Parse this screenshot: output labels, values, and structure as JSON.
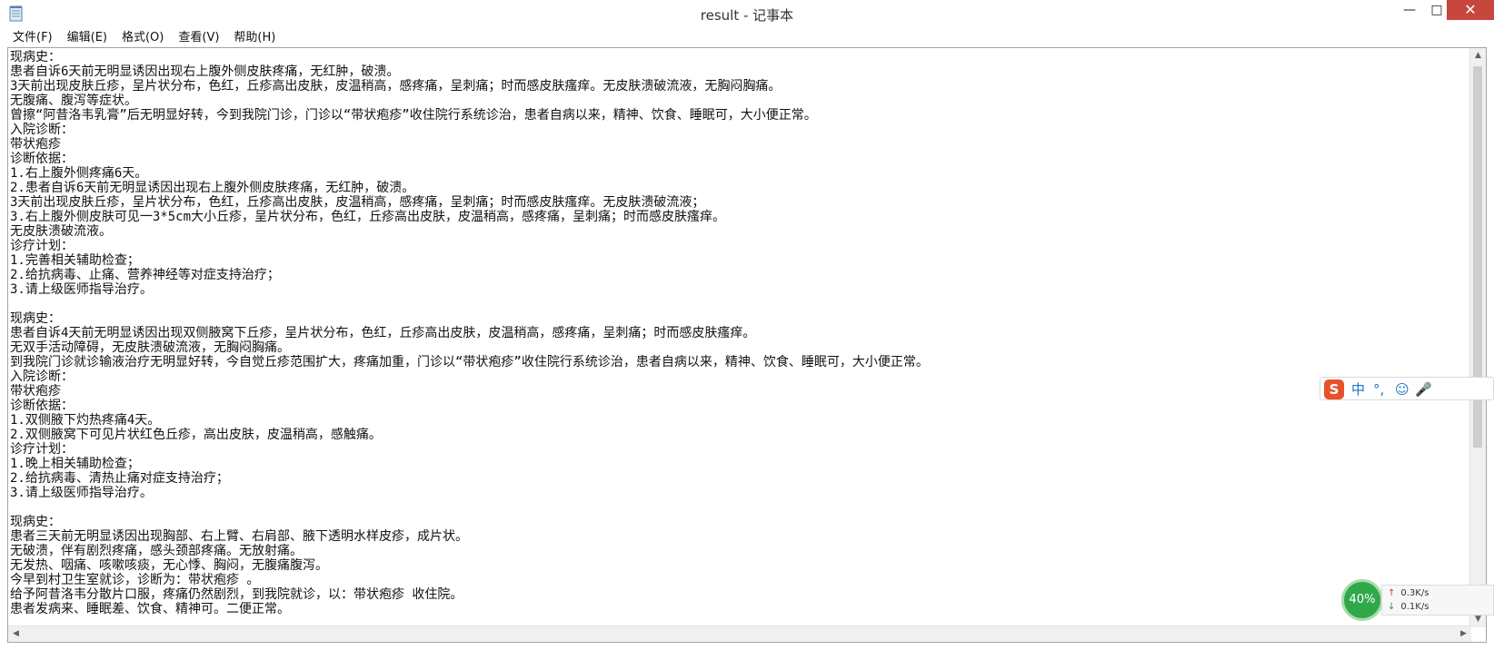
{
  "window": {
    "title": "result - 记事本",
    "minimize": "—",
    "maximize": "□",
    "close": "✕"
  },
  "menu": [
    "文件(F)",
    "编辑(E)",
    "格式(O)",
    "查看(V)",
    "帮助(H)"
  ],
  "editor": {
    "lines": [
      "现病史：",
      "患者自诉6天前无明显诱因出现右上腹外侧皮肤疼痛，无红肿，破溃。",
      "3天前出现皮肤丘疹，呈片状分布，色红，丘疹高出皮肤，皮温稍高，感疼痛，呈刺痛；时而感皮肤瘙痒。无皮肤溃破流液，无胸闷胸痛。",
      "无腹痛、腹泻等症状。",
      "曾擦“阿昔洛韦乳膏”后无明显好转，今到我院门诊，门诊以“带状疱疹”收住院行系统诊治，患者自病以来，精神、饮食、睡眠可，大小便正常。",
      "入院诊断：",
      "带状疱疹",
      "诊断依据：",
      "1.右上腹外侧疼痛6天。",
      "2.患者自诉6天前无明显诱因出现右上腹外侧皮肤疼痛，无红肿，破溃。",
      "3天前出现皮肤丘疹，呈片状分布，色红，丘疹高出皮肤，皮温稍高，感疼痛，呈刺痛；时而感皮肤瘙痒。无皮肤溃破流液；",
      "3.右上腹外侧皮肤可见一3*5cm大小丘疹，呈片状分布，色红，丘疹高出皮肤，皮温稍高，感疼痛，呈刺痛；时而感皮肤瘙痒。",
      "无皮肤溃破流液。",
      "诊疗计划：",
      "1.完善相关辅助检查；",
      "2.给抗病毒、止痛、营养神经等对症支持治疗；",
      "3.请上级医师指导治疗。",
      "",
      "现病史：",
      "患者自诉4天前无明显诱因出现双侧腋窝下丘疹，呈片状分布，色红，丘疹高出皮肤，皮温稍高，感疼痛，呈刺痛；时而感皮肤瘙痒。",
      "无双手活动障碍，无皮肤溃破流液，无胸闷胸痛。",
      "到我院门诊就诊输液治疗无明显好转，今自觉丘疹范围扩大，疼痛加重，门诊以“带状疱疹”收住院行系统诊治，患者自病以来，精神、饮食、睡眠可，大小便正常。",
      "入院诊断：",
      "带状疱疹",
      "诊断依据：",
      "1.双侧腋下灼热疼痛4天。",
      "2.双侧腋窝下可见片状红色丘疹，高出皮肤，皮温稍高，感触痛。",
      "诊疗计划：",
      "1.晚上相关辅助检查；",
      "2.给抗病毒、清热止痛对症支持治疗；",
      "3.请上级医师指导治疗。",
      "",
      "现病史：",
      "患者三天前无明显诱因出现胸部、右上臂、右肩部、腋下透明水样皮疹，成片状。",
      "无破溃，伴有剧烈疼痛，感头颈部疼痛。无放射痛。",
      "无发热、咽痛、咳嗽咳痰，无心悸、胸闷，无腹痛腹泻。",
      "今早到村卫生室就诊，诊断为：带状疱疹 。",
      "给予阿昔洛韦分散片口服，疼痛仍然剧烈，到我院就诊，以：带状疱疹 收住院。",
      "患者发病来、睡眠差、饮食、精神可。二便正常。"
    ]
  },
  "ime": {
    "logo": "S",
    "items": [
      "中",
      "°,",
      "☺",
      "🎤"
    ]
  },
  "network": {
    "percent": "40%",
    "upload": "0.3K/s",
    "download": "0.1K/s"
  }
}
